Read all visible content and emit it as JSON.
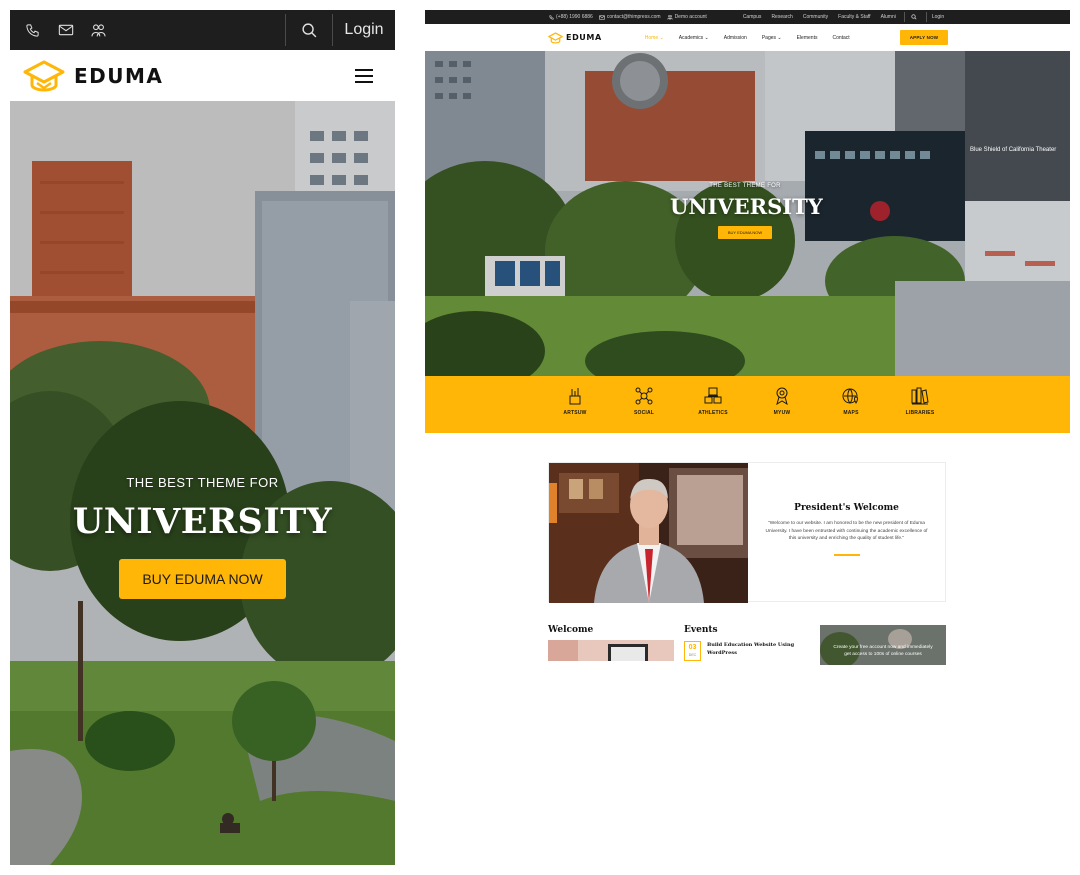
{
  "mobile": {
    "login_label": "Login",
    "logo_text": "EDUMA",
    "hero": {
      "subtitle": "THE BEST THEME FOR",
      "title": "UNIVERSITY",
      "button": "BUY EDUMA NOW"
    }
  },
  "desktop": {
    "topbar": {
      "phone": "(+88) 1990 6886",
      "email": "contact@thimpress.com",
      "demo": "Demo account",
      "links": [
        "Campus",
        "Research",
        "Community",
        "Faculty & Staff",
        "Alumni"
      ],
      "login": "Login"
    },
    "logo_text": "EDUMA",
    "menu": [
      {
        "label": "Home",
        "has_dropdown": true,
        "active": true
      },
      {
        "label": "Academics",
        "has_dropdown": true,
        "active": false
      },
      {
        "label": "Admission",
        "has_dropdown": false,
        "active": false
      },
      {
        "label": "Pages",
        "has_dropdown": true,
        "active": false
      },
      {
        "label": "Elements",
        "has_dropdown": false,
        "active": false
      },
      {
        "label": "Contact",
        "has_dropdown": false,
        "active": false
      }
    ],
    "apply_button": "APPLY NOW",
    "hero": {
      "subtitle": "THE BEST THEME FOR",
      "title": "UNIVERSITY",
      "button": "BUY EDUMA NOW",
      "sign_text": "Blue Shield of California Theater"
    },
    "features": [
      {
        "label": "ARTSUW",
        "icon": "art-supplies-icon"
      },
      {
        "label": "SOCIAL",
        "icon": "social-network-icon"
      },
      {
        "label": "ATHLETICS",
        "icon": "athletics-icon"
      },
      {
        "label": "MYUW",
        "icon": "award-badge-icon"
      },
      {
        "label": "MAPS",
        "icon": "map-pin-icon"
      },
      {
        "label": "LIBRARIES",
        "icon": "books-icon"
      }
    ],
    "president": {
      "title": "President's Welcome",
      "body": "\"Welcome to our website. I am honored to be the new president of Eduma University. I have been entrusted with continuing the academic excellence of this university and enriching the quality of student life.\""
    },
    "welcome": {
      "title": "Welcome"
    },
    "events": {
      "title": "Events",
      "items": [
        {
          "day": "03",
          "month": "DEC",
          "title": "Build Education Website Using WordPress"
        }
      ]
    },
    "promo": {
      "text": "Create your free account now and immediately get access to 100s of online courses"
    }
  },
  "colors": {
    "accent": "#ffb606",
    "topbar": "#1e1e1e"
  }
}
